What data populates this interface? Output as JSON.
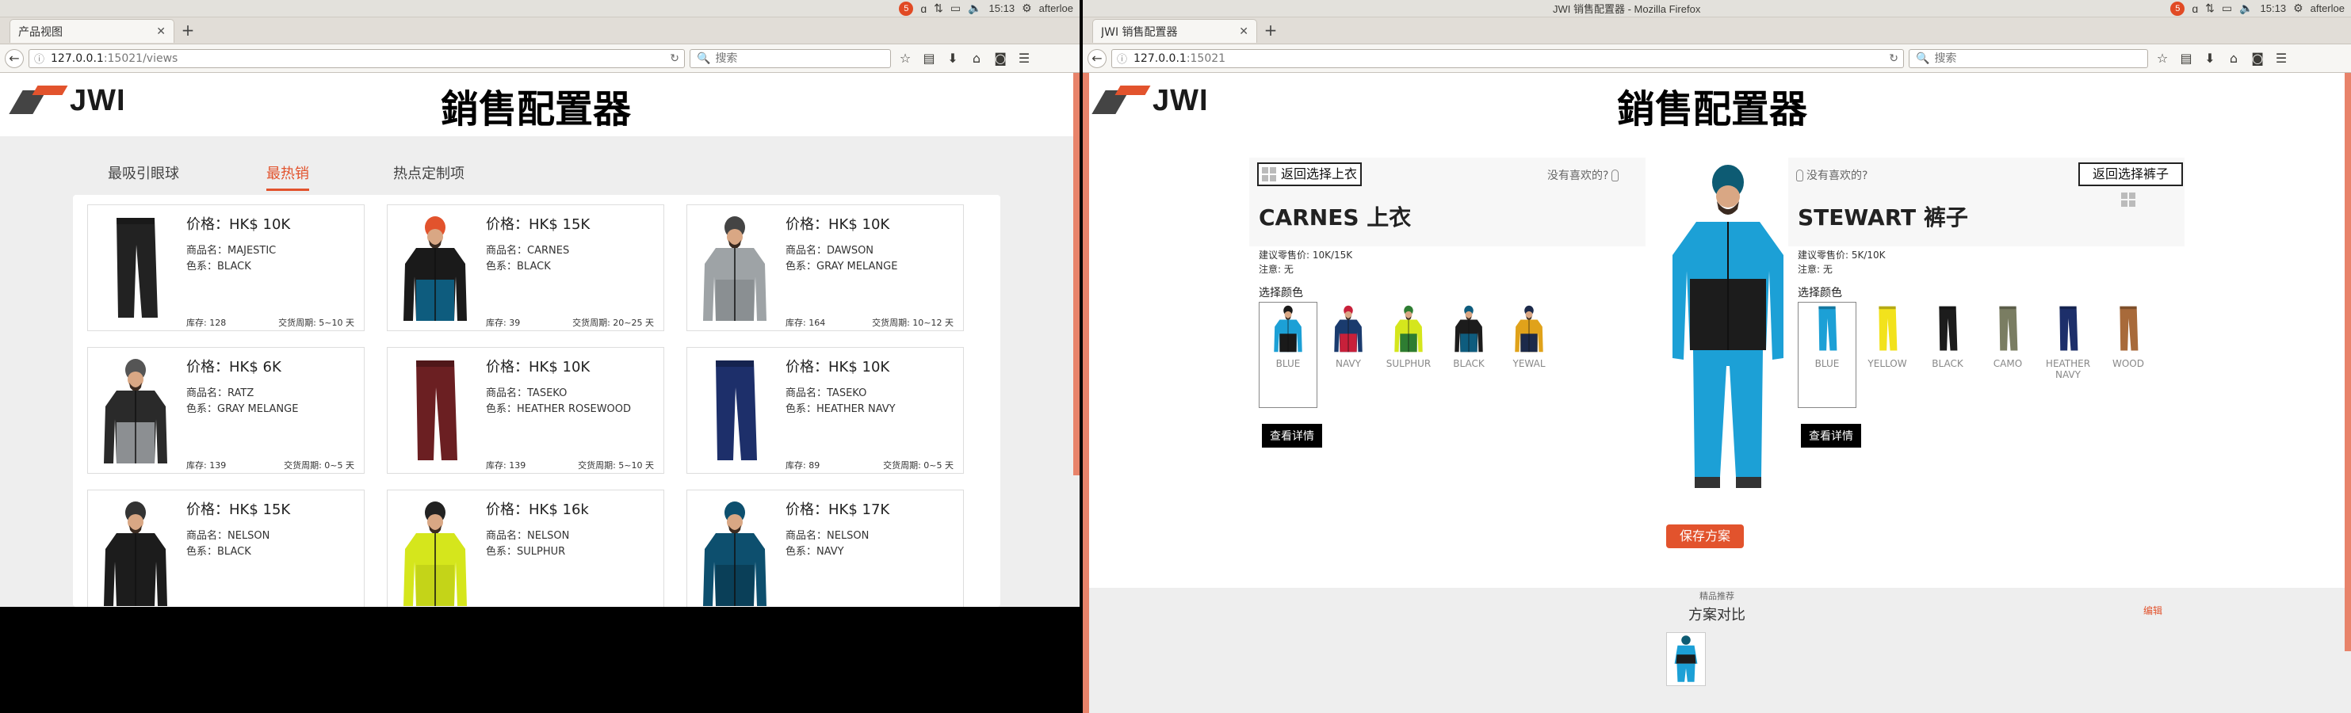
{
  "colors": {
    "accent": "#e2532d",
    "side_accent": "#e8836a",
    "logo_red": "#e2532d"
  },
  "left": {
    "tray": {
      "time": "15:13",
      "user": "afterloe",
      "badge": "5"
    },
    "tab_title": "产品视图",
    "url_host": "127.0.0.1",
    "url_rest": ":15021/views",
    "search_placeholder": "搜索",
    "logo": "JWI",
    "page_title": "銷售配置器",
    "categories": [
      "最吸引眼球",
      "最热销",
      "热点定制项"
    ],
    "products": [
      {
        "price": "价格：HK$ 10K",
        "name": "商品名：MAJESTIC",
        "color": "色系：BLACK",
        "stock": "库存: 128",
        "lead": "交货周期: 5~10 天",
        "kind": "pants",
        "c": "#222222"
      },
      {
        "price": "价格：HK$ 15K",
        "name": "商品名：CARNES",
        "color": "色系：BLACK",
        "stock": "库存: 39",
        "lead": "交货周期: 20~25 天",
        "kind": "jacket",
        "c": "#1a1a1a",
        "c2": "#0e5c7e",
        "hat": "#e2532d"
      },
      {
        "price": "价格：HK$ 10K",
        "name": "商品名：DAWSON",
        "color": "色系：GRAY MELANGE",
        "stock": "库存: 164",
        "lead": "交货周期: 10~12 天",
        "kind": "jacket",
        "c": "#9ea3a6",
        "c2": "#8a8f92",
        "hat": "#444444"
      },
      {
        "price": "价格：HK$ 6K",
        "name": "商品名：RATZ",
        "color": "色系：GRAY MELANGE",
        "stock": "库存: 139",
        "lead": "交货周期: 0~5 天",
        "kind": "jacket",
        "c": "#2a2a2a",
        "c2": "#8c8f92",
        "hat": "#555555"
      },
      {
        "price": "价格：HK$ 10K",
        "name": "商品名：TASEKO",
        "color": "色系：HEATHER ROSEWOOD",
        "stock": "库存: 139",
        "lead": "交货周期: 5~10 天",
        "kind": "pants",
        "c": "#6b1f22"
      },
      {
        "price": "价格：HK$ 10K",
        "name": "商品名：TASEKO",
        "color": "色系：HEATHER NAVY",
        "stock": "库存: 89",
        "lead": "交货周期: 0~5 天",
        "kind": "pants",
        "c": "#1d2f6a"
      },
      {
        "price": "价格：HK$ 15K",
        "name": "商品名：NELSON",
        "color": "色系：BLACK",
        "kind": "jacket",
        "c": "#1c1c1c",
        "c2": "#1c1c1c",
        "hat": "#333333"
      },
      {
        "price": "价格：HK$ 16k",
        "name": "商品名：NELSON",
        "color": "色系：SULPHUR",
        "kind": "jacket",
        "c": "#d5e61c",
        "c2": "#c4d418",
        "hat": "#222222"
      },
      {
        "price": "价格：HK$ 17K",
        "name": "商品名：NELSON",
        "color": "色系：NAVY",
        "kind": "jacket",
        "c": "#0d4f6e",
        "c2": "#0a3f58",
        "hat": "#0d4f6e"
      }
    ]
  },
  "right": {
    "window_title": "JWI 销售配置器 - Mozilla Firefox",
    "tray": {
      "time": "15:13",
      "user": "afterloe",
      "badge": "5"
    },
    "tab_title": "JWI 销售配置器",
    "url_host": "127.0.0.1",
    "url_rest": ":15021",
    "search_placeholder": "搜索",
    "logo": "JWI",
    "page_title": "銷售配置器",
    "top": {
      "back_label": "返回选择上衣",
      "hint": "没有喜欢的?",
      "title": "CARNES 上衣",
      "price": "建议零售价: 10K/15K",
      "note": "注意: 无",
      "select_color": "选择颜色",
      "swatches": [
        {
          "label": "BLUE",
          "c": "#1ca0d6",
          "c2": "#1a1a1a"
        },
        {
          "label": "NAVY",
          "c": "#1a3b6e",
          "c2": "#c8203a"
        },
        {
          "label": "SULPHUR",
          "c": "#d5e61c",
          "c2": "#2e7d32"
        },
        {
          "label": "BLACK",
          "c": "#1c1c1c",
          "c2": "#0e5c7e"
        },
        {
          "label": "YEWAL",
          "c": "#e0a21a",
          "c2": "#1c2a4a"
        }
      ],
      "details": "查看详情"
    },
    "bottom": {
      "back_label": "返回选择裤子",
      "hint": "没有喜欢的?",
      "title": "STEWART 裤子",
      "price": "建议零售价: 5K/10K",
      "note": "注意: 无",
      "select_color": "选择颜色",
      "swatches": [
        {
          "label": "BLUE",
          "c": "#1ca0d6"
        },
        {
          "label": "YELLOW",
          "c": "#f2e21c"
        },
        {
          "label": "BLACK",
          "c": "#1c1c1c"
        },
        {
          "label": "CAMO",
          "c": "#7a7d62"
        },
        {
          "label": "HEATHER NAVY",
          "c": "#1d2f6a"
        },
        {
          "label": "WOOD",
          "c": "#a86a3a"
        }
      ],
      "details": "查看详情"
    },
    "save": "保存方案",
    "recommend": "精品推荐",
    "compare": "方案对比",
    "edit": "编辑"
  }
}
